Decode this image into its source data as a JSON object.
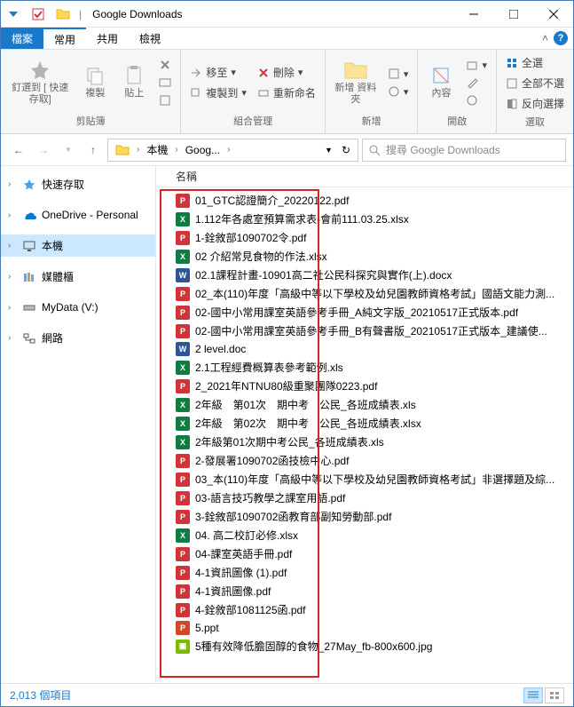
{
  "titlebar": {
    "title": "Google Downloads"
  },
  "menu": {
    "file": "檔案",
    "home": "常用",
    "share": "共用",
    "view": "檢視"
  },
  "ribbon": {
    "clipboard": {
      "label": "剪貼簿",
      "pin": "釘選到 [\n快速存取]",
      "copy": "複製",
      "paste": "貼上"
    },
    "organize": {
      "label": "組合管理",
      "moveto": "移至",
      "copyto": "複製到",
      "delete": "刪除",
      "rename": "重新命名"
    },
    "new": {
      "label": "新增",
      "newfolder": "新增\n資料夾"
    },
    "open": {
      "label": "開啟",
      "props": "內容"
    },
    "select": {
      "label": "選取",
      "all": "全選",
      "none": "全部不選",
      "invert": "反向選擇"
    }
  },
  "nav": {
    "pc": "本機",
    "folder": "Goog...",
    "refresh": "↻"
  },
  "search": {
    "placeholder": "搜尋 Google Downloads"
  },
  "sidebar": {
    "items": [
      {
        "label": "快速存取"
      },
      {
        "label": "OneDrive - Personal"
      },
      {
        "label": "本機"
      },
      {
        "label": "媒體櫃"
      },
      {
        "label": "MyData (V:)"
      },
      {
        "label": "網路"
      }
    ]
  },
  "columns": {
    "name": "名稱"
  },
  "files": [
    {
      "name": "01_GTC認證簡介_20220122.pdf",
      "type": "pdf"
    },
    {
      "name": "1.112年各處室預算需求表-會前111.03.25.xlsx",
      "type": "xlsx"
    },
    {
      "name": "1-銓敘部1090702令.pdf",
      "type": "pdf"
    },
    {
      "name": "02 介紹常見食物的作法.xlsx",
      "type": "xlsx"
    },
    {
      "name": "02.1課程計畫-10901高二社公民科探究與實作(上).docx",
      "type": "docx"
    },
    {
      "name": "02_本(110)年度「高級中等以下學校及幼兒園教師資格考試」國語文能力測...",
      "type": "pdf"
    },
    {
      "name": "02-國中小常用課室英語參考手冊_A純文字版_20210517正式版本.pdf",
      "type": "pdf"
    },
    {
      "name": "02-國中小常用課室英語參考手冊_B有聲書版_20210517正式版本_建議使...",
      "type": "pdf"
    },
    {
      "name": "2 level.doc",
      "type": "doc"
    },
    {
      "name": "2.1工程經費概算表參考範例.xls",
      "type": "xls"
    },
    {
      "name": "2_2021年NTNU80級重聚團隊0223.pdf",
      "type": "pdf"
    },
    {
      "name": "2年級　第01次　期中考　公民_各班成績表.xls",
      "type": "xls"
    },
    {
      "name": "2年級　第02次　期中考　公民_各班成績表.xlsx",
      "type": "xlsx"
    },
    {
      "name": "2年級第01次期中考公民_各班成績表.xls",
      "type": "xls"
    },
    {
      "name": "2-發展署1090702函技檢中心.pdf",
      "type": "pdf"
    },
    {
      "name": "03_本(110)年度「高級中等以下學校及幼兒園教師資格考試」非選擇題及綜...",
      "type": "pdf"
    },
    {
      "name": "03-語言技巧教學之課室用語.pdf",
      "type": "pdf"
    },
    {
      "name": "3-銓敘部1090702函教育部副知勞動部.pdf",
      "type": "pdf"
    },
    {
      "name": "04. 高二校訂必修.xlsx",
      "type": "xlsx"
    },
    {
      "name": "04-課室英語手冊.pdf",
      "type": "pdf"
    },
    {
      "name": "4-1資訊圖像 (1).pdf",
      "type": "pdf"
    },
    {
      "name": "4-1資訊圖像.pdf",
      "type": "pdf"
    },
    {
      "name": "4-銓敘部1081125函.pdf",
      "type": "pdf"
    },
    {
      "name": "5.ppt",
      "type": "ppt"
    },
    {
      "name": "5種有效降低膽固醇的食物_27May_fb-800x600.jpg",
      "type": "jpg"
    }
  ],
  "status": {
    "items": "2,013 個項目"
  },
  "icon_labels": {
    "pdf": "P",
    "xlsx": "X",
    "docx": "W",
    "doc": "W",
    "xls": "X",
    "ppt": "P",
    "jpg": "▣"
  }
}
